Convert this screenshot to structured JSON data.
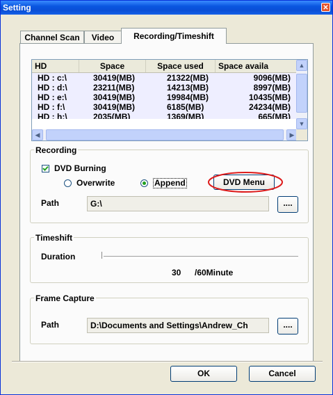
{
  "window": {
    "title": "Setting",
    "close_glyph": "✕"
  },
  "tabs": [
    {
      "label": "Channel Scan"
    },
    {
      "label": "Video"
    },
    {
      "label": "Recording/Timeshift"
    }
  ],
  "drive_list": {
    "headers": [
      "HD",
      "Space",
      "Space used",
      "Space availa"
    ],
    "rows": [
      {
        "hd": "HD : c:\\",
        "space": "30419(MB)",
        "used": "21322(MB)",
        "avail": "9096(MB)"
      },
      {
        "hd": "HD : d:\\",
        "space": "23211(MB)",
        "used": "14213(MB)",
        "avail": "8997(MB)"
      },
      {
        "hd": "HD : e:\\",
        "space": "30419(MB)",
        "used": "19984(MB)",
        "avail": "10435(MB)"
      },
      {
        "hd": "HD : f:\\",
        "space": "30419(MB)",
        "used": "6185(MB)",
        "avail": "24234(MB)"
      },
      {
        "hd": "HD : h:\\",
        "space": "2035(MB)",
        "used": "1369(MB)",
        "avail": "665(MB)"
      }
    ]
  },
  "recording": {
    "group_label": "Recording",
    "dvd_burning_label": "DVD Burning",
    "dvd_burning_checked": true,
    "overwrite_label": "Overwrite",
    "append_label": "Append",
    "selected_mode": "Append",
    "dvd_menu_label": "DVD Menu",
    "path_label": "Path",
    "path_value": "G:\\",
    "browse_label": "...."
  },
  "timeshift": {
    "group_label": "Timeshift",
    "duration_label": "Duration",
    "duration_value": "30",
    "duration_max_text": "/60Minute",
    "slider_fraction": 0.0
  },
  "frame_capture": {
    "group_label": "Frame Capture",
    "path_label": "Path",
    "path_value": "D:\\Documents and Settings\\Andrew_Ch",
    "browse_label": "...."
  },
  "footer": {
    "ok_label": "OK",
    "cancel_label": "Cancel"
  },
  "colors": {
    "annotation_circle": "#dd1a1a",
    "titlebar": "#0a56e0"
  }
}
